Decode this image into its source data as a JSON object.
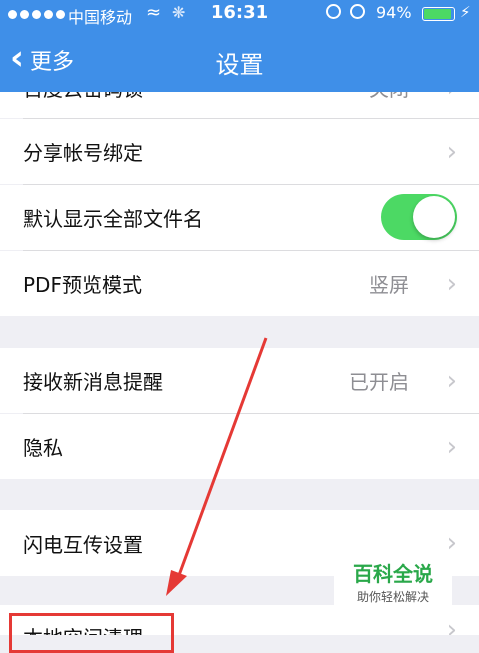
{
  "status_bar": {
    "carrier": "中国移动",
    "time": "16:31",
    "battery_pct": "94%",
    "battery_level": 0.94
  },
  "nav": {
    "back_label": "更多",
    "title": "设置"
  },
  "groups": {
    "group1": [
      {
        "label": "百度云密码锁",
        "value": "关闭"
      },
      {
        "label": "分享帐号绑定",
        "value": ""
      },
      {
        "label": "默认显示全部文件名",
        "toggle": true
      },
      {
        "label": "PDF预览模式",
        "value": "竖屏"
      }
    ],
    "group2": [
      {
        "label": "接收新消息提醒",
        "value": "已开启"
      },
      {
        "label": "隐私",
        "value": ""
      }
    ],
    "group3": [
      {
        "label": "闪电互传设置",
        "value": ""
      }
    ],
    "group4": [
      {
        "label": "本地空间清理",
        "value": ""
      }
    ]
  },
  "watermark": {
    "title": "百科全说",
    "subtitle": "助你轻松解决"
  },
  "colors": {
    "nav": "#3f8fe8",
    "toggle_on": "#4cd964",
    "annotation": "#e53935",
    "watermark_green": "#2aa84a"
  }
}
